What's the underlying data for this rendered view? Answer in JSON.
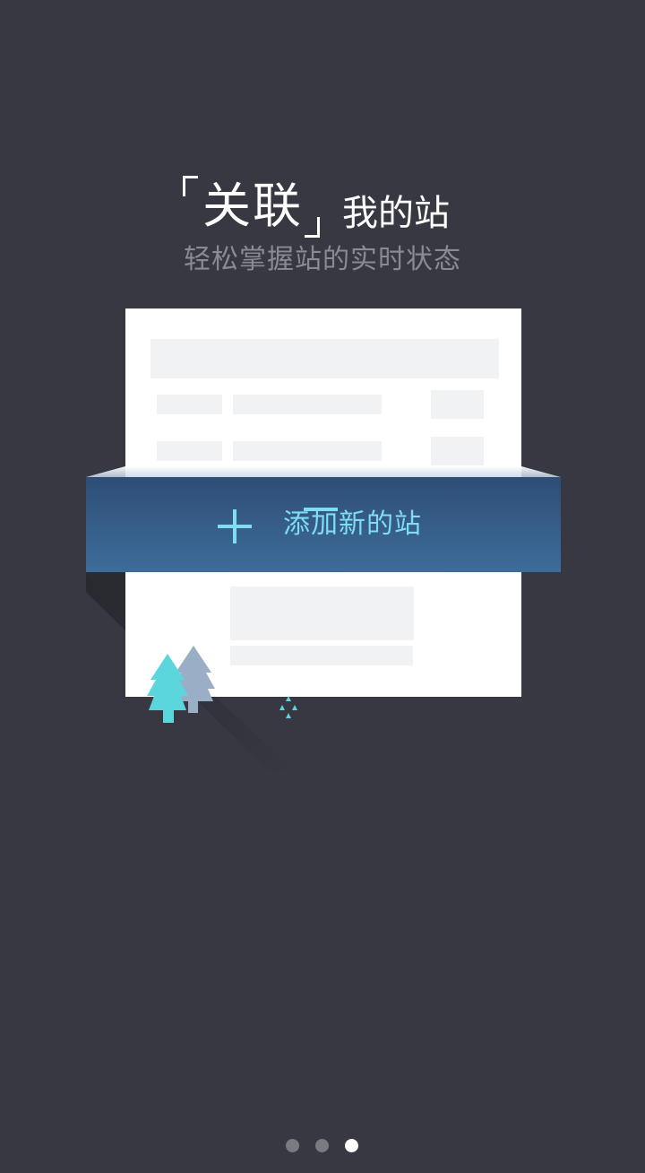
{
  "headline": {
    "title_main": "关联",
    "title_rest": "我的站",
    "subtitle": "轻松掌握站的实时状态"
  },
  "card": {
    "add_button_label": "添加新的站",
    "add_button_icon": "plus-icon"
  },
  "pager": {
    "count": 3,
    "active_index": 2
  },
  "colors": {
    "background": "#373841",
    "accent_text": "#7fdcf2",
    "banner_top": "#2e5077",
    "banner_bottom": "#3d6b9a",
    "tree_primary": "#5ad6dc",
    "tree_secondary": "#9aafc6"
  }
}
